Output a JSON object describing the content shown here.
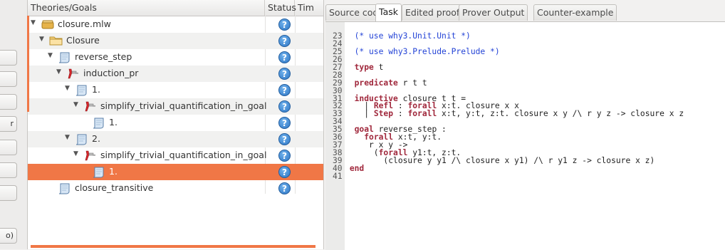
{
  "left_toolbar": {
    "button_labels": [
      "",
      "",
      "",
      "r",
      "",
      "",
      "",
      "o)"
    ]
  },
  "tree": {
    "columns": [
      "Theories/Goals",
      "Status",
      "Tim"
    ],
    "rows": [
      {
        "label": "closure.mlw",
        "icon": "file-icon",
        "expanded": true,
        "depth": 0,
        "status": "?"
      },
      {
        "label": "Closure",
        "icon": "folder-icon",
        "expanded": true,
        "depth": 1,
        "status": "?"
      },
      {
        "label": "reverse_step",
        "icon": "goal-scroll-icon",
        "expanded": true,
        "depth": 2,
        "status": "?"
      },
      {
        "label": "induction_pr",
        "icon": "transformation-icon",
        "expanded": true,
        "depth": 3,
        "status": "?"
      },
      {
        "label": "1.",
        "icon": "goal-scroll-icon",
        "expanded": true,
        "depth": 4,
        "status": "?"
      },
      {
        "label": "simplify_trivial_quantification_in_goal",
        "icon": "transformation-icon",
        "expanded": true,
        "depth": 5,
        "status": "?"
      },
      {
        "label": "1.",
        "icon": "goal-scroll-icon",
        "expanded": false,
        "depth": 6,
        "status": "?"
      },
      {
        "label": "2.",
        "icon": "goal-scroll-icon",
        "expanded": true,
        "depth": 4,
        "status": "?"
      },
      {
        "label": "simplify_trivial_quantification_in_goal",
        "icon": "transformation-icon",
        "expanded": true,
        "depth": 5,
        "status": "?"
      },
      {
        "label": "1.",
        "icon": "goal-scroll-icon",
        "expanded": false,
        "depth": 6,
        "status": "?",
        "selected": true
      },
      {
        "label": "closure_transitive",
        "icon": "goal-scroll-icon",
        "expanded": false,
        "depth": 2,
        "status": "?"
      }
    ]
  },
  "tabs": [
    "Source code",
    "Task",
    "Edited proof",
    "Prover Output",
    "Counter-example"
  ],
  "active_tab": "Task",
  "code": {
    "lines": [
      {
        "n": "23",
        "parts": [
          {
            "t": "  (* use why3.Unit.Unit *)",
            "c": "cm"
          }
        ]
      },
      {
        "n": "24",
        "parts": []
      },
      {
        "n": "25",
        "parts": [
          {
            "t": "  (* use why3.Prelude.Prelude *)",
            "c": "cm"
          }
        ]
      },
      {
        "n": "26",
        "parts": []
      },
      {
        "n": "27",
        "parts": [
          {
            "t": "  ",
            "c": "tx"
          },
          {
            "t": "type",
            "c": "kw"
          },
          {
            "t": " t",
            "c": "tx"
          }
        ]
      },
      {
        "n": "28",
        "parts": []
      },
      {
        "n": "29",
        "parts": [
          {
            "t": "  ",
            "c": "tx"
          },
          {
            "t": "predicate",
            "c": "kw"
          },
          {
            "t": " r t t",
            "c": "tx"
          }
        ]
      },
      {
        "n": "30",
        "parts": []
      },
      {
        "n": "31",
        "parts": [
          {
            "t": "  ",
            "c": "tx"
          },
          {
            "t": "inductive",
            "c": "kw"
          },
          {
            "t": " closure t t =",
            "c": "tx"
          }
        ]
      },
      {
        "n": "32",
        "parts": [
          {
            "t": "    | ",
            "c": "tx"
          },
          {
            "t": "Refl",
            "c": "kw"
          },
          {
            "t": " : ",
            "c": "tx"
          },
          {
            "t": "forall",
            "c": "kw"
          },
          {
            "t": " x:t. closure x x",
            "c": "tx"
          }
        ]
      },
      {
        "n": "33",
        "parts": [
          {
            "t": "    | ",
            "c": "tx"
          },
          {
            "t": "Step",
            "c": "kw"
          },
          {
            "t": " : ",
            "c": "tx"
          },
          {
            "t": "forall",
            "c": "kw"
          },
          {
            "t": " x:t, y:t, z:t. closure x y /\\ r y z -> closure x z",
            "c": "tx"
          }
        ]
      },
      {
        "n": "34",
        "parts": []
      },
      {
        "n": "35",
        "parts": [
          {
            "t": "  ",
            "c": "tx"
          },
          {
            "t": "goal",
            "c": "kw"
          },
          {
            "t": " reverse_step :",
            "c": "tx"
          }
        ]
      },
      {
        "n": "36",
        "parts": [
          {
            "t": "    ",
            "c": "tx"
          },
          {
            "t": "forall",
            "c": "kw"
          },
          {
            "t": " x:t, y:t.",
            "c": "tx"
          }
        ]
      },
      {
        "n": "37",
        "parts": [
          {
            "t": "     r x y ->",
            "c": "tx"
          }
        ]
      },
      {
        "n": "38",
        "parts": [
          {
            "t": "      (",
            "c": "tx"
          },
          {
            "t": "forall",
            "c": "kw"
          },
          {
            "t": " y1:t, z:t.",
            "c": "tx"
          }
        ]
      },
      {
        "n": "39",
        "parts": [
          {
            "t": "        (closure y y1 /\\ closure x y1) /\\ r y1 z -> closure x z)",
            "c": "tx"
          }
        ]
      },
      {
        "n": "40",
        "parts": [
          {
            "t": " ",
            "c": "tx"
          },
          {
            "t": "end",
            "c": "kw"
          }
        ]
      },
      {
        "n": "41",
        "parts": []
      }
    ]
  }
}
